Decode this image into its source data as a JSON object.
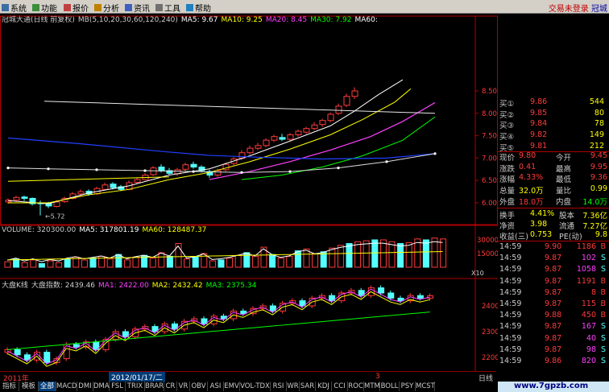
{
  "menu": {
    "items": [
      {
        "label": "系统",
        "icon": "system-icon"
      },
      {
        "label": "功能",
        "icon": "function-icon"
      },
      {
        "label": "报价",
        "icon": "quote-icon"
      },
      {
        "label": "分析",
        "icon": "analysis-icon"
      },
      {
        "label": "资讯",
        "icon": "news-icon"
      },
      {
        "label": "工具",
        "icon": "tools-icon"
      },
      {
        "label": "帮助",
        "icon": "help-icon"
      }
    ],
    "login_status": "交易未登录",
    "stock_short": "冠城"
  },
  "price_panel": {
    "title": "冠城大通(日线 前复权)",
    "indicator": "MB(5,10,20,30,60,120,240)",
    "ma5": "MA5: 9.67",
    "ma10": "MA10: 9.25",
    "ma20": "MA20: 8.45",
    "ma30": "MA30: 7.92",
    "ma60": "MA60:",
    "low_marker": "5.72",
    "y_ticks": [
      "8.50",
      "8.00",
      "7.50",
      "7.00",
      "6.50",
      "6.00"
    ]
  },
  "volume_panel": {
    "title": "VOLUME: 320300.00",
    "ma5": "MA5: 317801.19",
    "ma60": "MA60: 128487.37",
    "y_ticks": [
      "30000",
      "15000"
    ],
    "unit": "X10"
  },
  "index_panel": {
    "title": "大盘K线",
    "index": "大盘指数: 2439.46",
    "ma1": "MA1: 2422.00",
    "ma2": "MA2: 2432.42",
    "ma3": "MA3: 2375.34",
    "y_ticks": [
      "2400",
      "2300",
      "2200"
    ]
  },
  "bottom_axis": {
    "year": "2011年",
    "date_box": "2012/01/17/二",
    "month_marker": "3",
    "period": "日线"
  },
  "tabs": [
    "指标",
    "模板",
    "全部",
    "MACD",
    "DMI",
    "DMA",
    "FSL",
    "TRIX",
    "BRAR",
    "CR",
    "VR",
    "OBV",
    "ASI",
    "EMV",
    "VOL-TDX",
    "RSI",
    "WR",
    "SAR",
    "KDJ",
    "CCI",
    "ROC",
    "MTM",
    "BOLL",
    "PSY",
    "MCST"
  ],
  "active_tab_index": 2,
  "watermark": "www.7gpzb.com",
  "quote": {
    "bids": [
      {
        "label": "买①",
        "price": "9.86",
        "vol": "544"
      },
      {
        "label": "买②",
        "price": "9.85",
        "vol": "80"
      },
      {
        "label": "买③",
        "price": "9.84",
        "vol": "78"
      },
      {
        "label": "买④",
        "price": "9.82",
        "vol": "149"
      },
      {
        "label": "买⑤",
        "price": "9.81",
        "vol": "212"
      }
    ],
    "stats": [
      {
        "l1": "现价",
        "v1": "9.80",
        "l2": "今开",
        "v2": "9.45"
      },
      {
        "l1": "涨跌",
        "v1": "0.41",
        "l2": "最高",
        "v2": "9.95"
      },
      {
        "l1": "涨幅",
        "v1": "4.33%",
        "l2": "最低",
        "v2": "9.36"
      },
      {
        "l1": "总量",
        "v1": "32.0万",
        "l2": "量比",
        "v2": "0.99"
      },
      {
        "l1": "外盘",
        "v1": "18.0万",
        "l2": "内盘",
        "v2": "14.0万"
      }
    ],
    "stats2": [
      {
        "l1": "换手",
        "v1": "4.41%",
        "l2": "股本",
        "v2": "7.36亿"
      },
      {
        "l1": "净资",
        "v1": "3.98",
        "l2": "流通",
        "v2": "7.27亿"
      },
      {
        "l1": "收益(三)",
        "v1": "0.753",
        "l2": "PE(动)",
        "v2": "9.8"
      }
    ],
    "ticks": [
      {
        "time": "14:59",
        "price": "9.90",
        "vol": "1186",
        "side": "B"
      },
      {
        "time": "14:59",
        "price": "9.87",
        "vol": "102",
        "side": "S"
      },
      {
        "time": "14:59",
        "price": "9.87",
        "vol": "1058",
        "side": "S"
      },
      {
        "time": "14:59",
        "price": "9.87",
        "vol": "1191",
        "side": "B"
      },
      {
        "time": "14:59",
        "price": "9.87",
        "vol": "8",
        "side": "B"
      },
      {
        "time": "14:59",
        "price": "9.87",
        "vol": "115",
        "side": "B"
      },
      {
        "time": "14:59",
        "price": "9.88",
        "vol": "450",
        "side": "B"
      },
      {
        "time": "14:59",
        "price": "9.87",
        "vol": "167",
        "side": "S"
      },
      {
        "time": "14:59",
        "price": "9.87",
        "vol": "40",
        "side": "S"
      },
      {
        "time": "14:59",
        "price": "9.87",
        "vol": "98",
        "side": "S"
      },
      {
        "time": "14:59",
        "price": "9.86",
        "vol": "820",
        "side": "S"
      }
    ]
  },
  "colors": {
    "up": "#ff3b3b",
    "down": "#54ffff",
    "ma5": "#ffffff",
    "ma10": "#ffff00",
    "ma20": "#ff40ff",
    "ma30": "#00ff00",
    "ma60": "#ffffff",
    "ma120": "#2040ff",
    "border": "#b00000"
  }
}
